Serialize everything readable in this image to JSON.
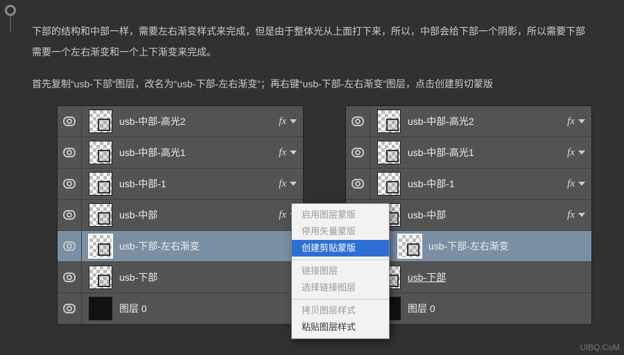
{
  "article": {
    "paragraph1": "下部的结构和中部一样，需要左右渐变样式来完成，但是由于整体光从上面打下来，所以，中部会给下部一个阴影，所以需要下部需要一个左右渐变和一个上下渐变来完成。",
    "paragraph2": "首先复制“usb-下部”图层，改名为“usb-下部-左右渐变”；再右键“usb-下部-左右渐变”图层，点击创建剪切蒙版"
  },
  "fx_label": "fx",
  "panelA": {
    "layers": [
      {
        "name": "usb-中部-高光2",
        "fx": true,
        "drop": true
      },
      {
        "name": "usb-中部-高光1",
        "fx": true,
        "drop": true
      },
      {
        "name": "usb-中部-1",
        "fx": true,
        "drop": true
      },
      {
        "name": "usb-中部",
        "fx": true,
        "drop": true
      },
      {
        "name": "usb-下部-左右渐变",
        "fx": false,
        "drop": false,
        "selected": true
      },
      {
        "name": "usb-下部",
        "fx": false,
        "drop": false
      },
      {
        "name": "图层 0",
        "fx": false,
        "drop": false,
        "solid": true
      }
    ]
  },
  "context_menu": {
    "sections": [
      [
        {
          "label": "启用图层蒙版",
          "state": "disabled"
        },
        {
          "label": "停用矢量蒙版",
          "state": "disabled"
        },
        {
          "label": "创建剪贴蒙版",
          "state": "highlight"
        }
      ],
      [
        {
          "label": "链接图层",
          "state": "disabled"
        },
        {
          "label": "选择链接图层",
          "state": "disabled"
        }
      ],
      [
        {
          "label": "拷贝图层样式",
          "state": "disabled"
        },
        {
          "label": "粘贴图层样式",
          "state": "normal"
        }
      ]
    ]
  },
  "panelB": {
    "layers": [
      {
        "name": "usb-中部-高光2",
        "fx": true,
        "drop": true
      },
      {
        "name": "usb-中部-高光1",
        "fx": true,
        "drop": true
      },
      {
        "name": "usb-中部-1",
        "fx": true,
        "drop": true
      },
      {
        "name": "usb-中部",
        "fx": true,
        "drop": true
      },
      {
        "name": "usb-下部-左右渐变",
        "fx": false,
        "drop": false,
        "selected": true,
        "clip": true
      },
      {
        "name": "usb-下部",
        "fx": false,
        "drop": false,
        "underline": true
      },
      {
        "name": "图层 0",
        "fx": false,
        "drop": false,
        "solid": true
      }
    ]
  },
  "watermark": "UiBQ.CoM"
}
